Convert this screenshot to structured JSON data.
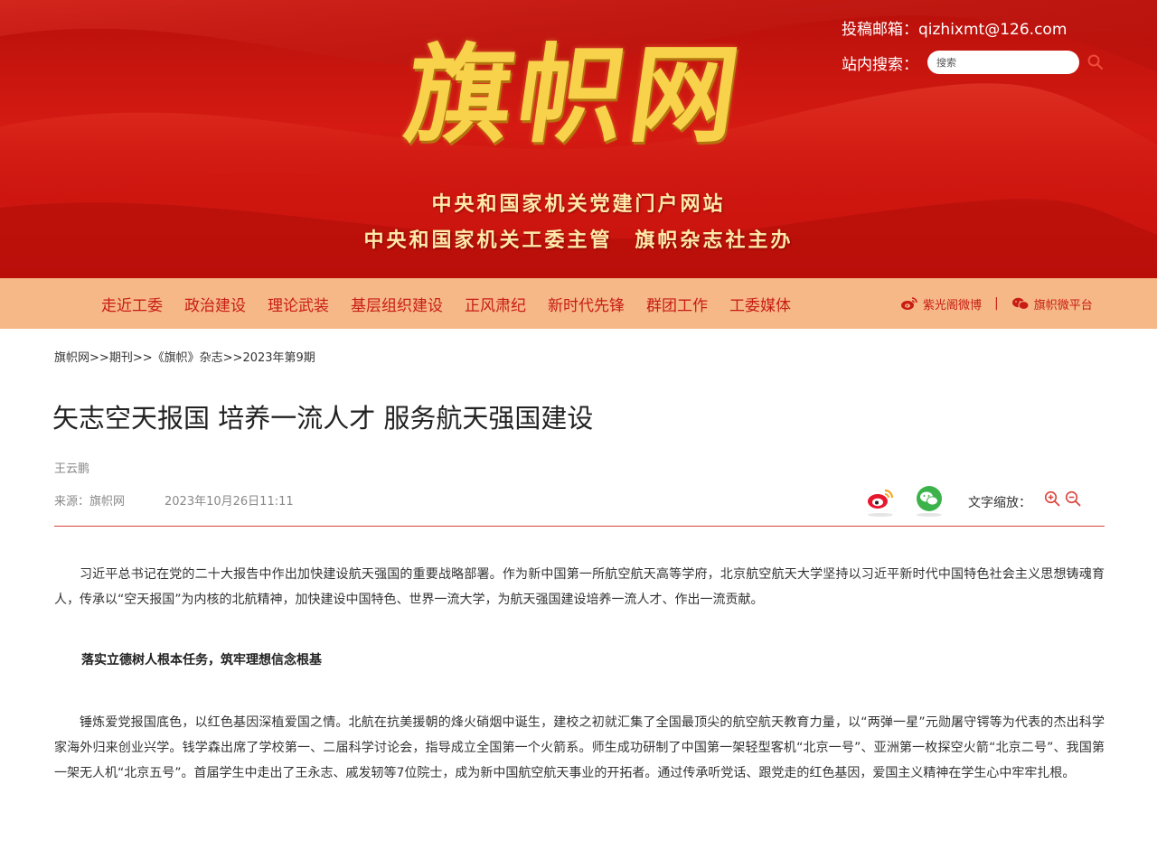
{
  "header": {
    "logo_text": "旗帜网",
    "subtitle_line1": "中央和国家机关党建门户网站",
    "subtitle_line2": "中央和国家机关工委主管　旗帜杂志社主办",
    "contact": "投稿邮箱：qizhixmt@126.com",
    "search_label": "站内搜索：",
    "search_placeholder": "搜索",
    "search_icon": "search-icon",
    "banner_color": "#c8120c",
    "logo_color": "#f7d24a"
  },
  "nav": {
    "items": [
      {
        "label": "走近工委"
      },
      {
        "label": "政治建设"
      },
      {
        "label": "理论武装"
      },
      {
        "label": "基层组织建设"
      },
      {
        "label": "正风肃纪"
      },
      {
        "label": "新时代先锋"
      },
      {
        "label": "群团工作"
      },
      {
        "label": "工委媒体"
      }
    ],
    "weibo_label": "紫光阁微博",
    "separator": "|",
    "wechat_label": "旗帜微平台",
    "background": "#f6b887",
    "text_color": "#c81d14"
  },
  "breadcrumb": {
    "items": [
      "旗帜网",
      "期刊",
      "《旗帜》杂志",
      "2023年第9期"
    ],
    "separator": ">>"
  },
  "article": {
    "title": "矢志空天报国 培养一流人才 服务航天强国建设",
    "author": "王云鹏",
    "source": "来源：旗帜网",
    "date": "2023年10月26日11:11",
    "font_zoom_label": "文字缩放：",
    "paragraph1": "习近平总书记在党的二十大报告中作出加快建设航天强国的重要战略部署。作为新中国第一所航空航天高等学府，北京航空航天大学坚持以习近平新时代中国特色社会主义思想铸魂育人，传承以“空天报国”为内核的北航精神，加快建设中国特色、世界一流大学，为航天强国建设培养一流人才、作出一流贡献。",
    "subheading1": "落实立德树人根本任务，筑牢理想信念根基",
    "paragraph2": "锤炼爱党报国底色，以红色基因深植爱国之情。北航在抗美援朝的烽火硝烟中诞生，建校之初就汇集了全国最顶尖的航空航天教育力量，以“两弹一星”元勋屠守锷等为代表的杰出科学家海外归来创业兴学。钱学森出席了学校第一、二届科学讨论会，指导成立全国第一个火箭系。师生成功研制了中国第一架轻型客机“北京一号”、亚洲第一枚探空火箭“北京二号”、我国第一架无人机“北京五号”。首届学生中走出了王永志、戚发轫等7位院士，成为新中国航空航天事业的开拓者。通过传承听党话、跟党走的红色基因，爱国主义精神在学生心中牢牢扎根。",
    "divider_color": "#d9443c"
  }
}
